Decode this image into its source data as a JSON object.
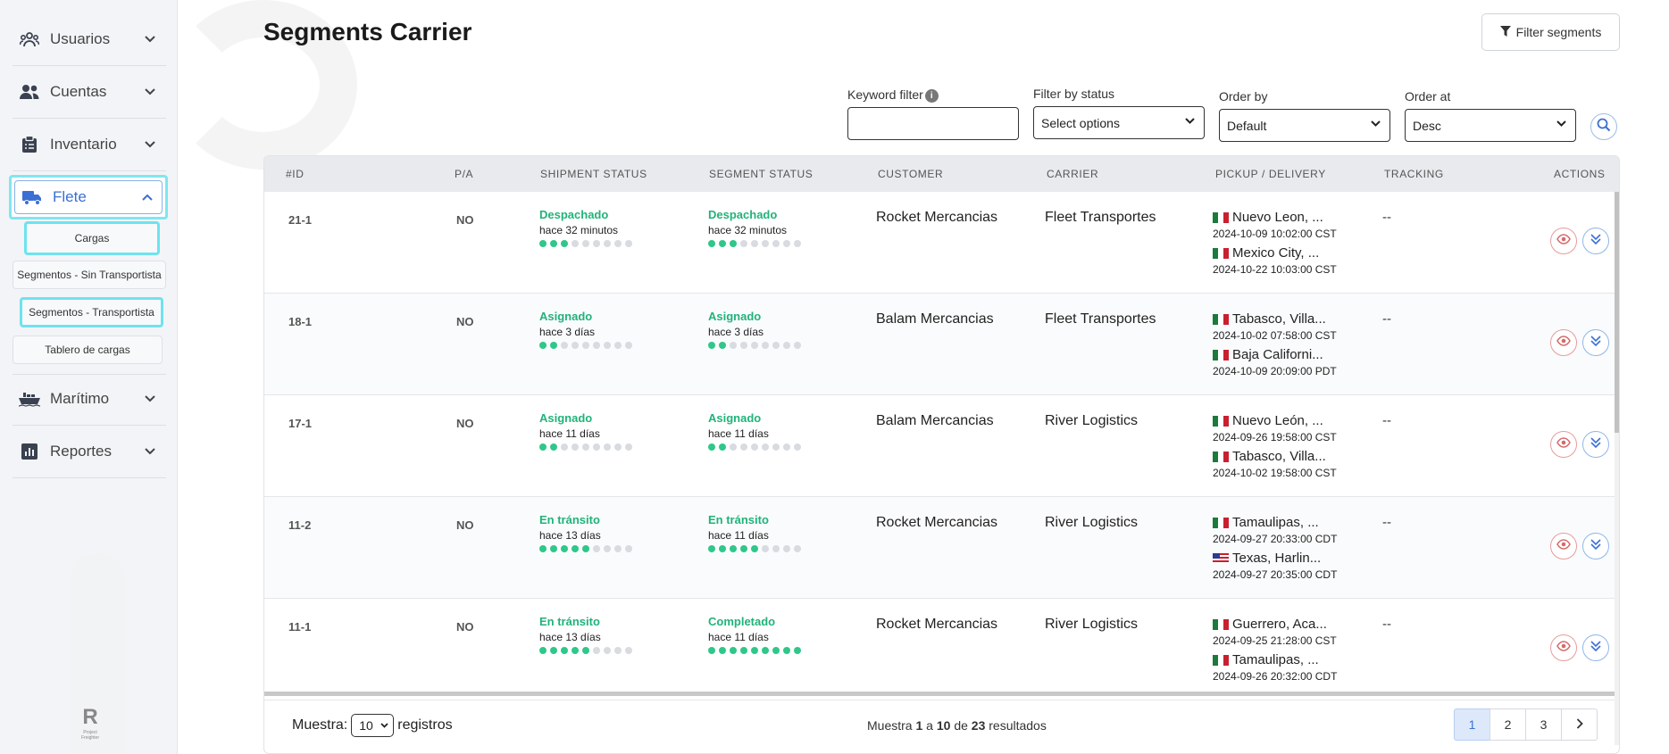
{
  "sidebar": {
    "items": [
      {
        "label": "Usuarios",
        "icon": "users-group-icon",
        "chevron": "chevron-down-icon"
      },
      {
        "label": "Cuentas",
        "icon": "user-pair-icon",
        "chevron": "chevron-down-icon"
      },
      {
        "label": "Inventario",
        "icon": "clipboard-icon",
        "chevron": "chevron-down-icon"
      },
      {
        "label": "Flete",
        "icon": "truck-icon",
        "chevron": "chevron-up-icon"
      },
      {
        "label": "Marítimo",
        "icon": "ship-icon",
        "chevron": "chevron-down-icon"
      },
      {
        "label": "Reportes",
        "icon": "chart-icon",
        "chevron": "chevron-down-icon"
      }
    ],
    "subitems": [
      "Cargas",
      "Segmentos - Sin Transportista",
      "Segmentos - Transportista",
      "Tablero de cargas"
    ],
    "logo": {
      "mark": "R",
      "caption": "Project Freighter"
    }
  },
  "header": {
    "title": "Segments Carrier",
    "filter_button": "Filter segments"
  },
  "filters": {
    "keyword_label": "Keyword filter",
    "keyword_value": "",
    "status_label": "Filter by status",
    "status_value": "Select options",
    "order_by_label": "Order by",
    "order_by_value": "Default",
    "order_at_label": "Order at",
    "order_at_value": "Desc"
  },
  "table": {
    "columns": [
      "#ID",
      "P/A",
      "SHIPMENT STATUS",
      "SEGMENT STATUS",
      "CUSTOMER",
      "CARRIER",
      "PICKUP / DELIVERY",
      "TRACKING",
      "ACTIONS"
    ],
    "rows": [
      {
        "id": "21-1",
        "pa": "NO",
        "ship_status": "Despachado",
        "ship_time": "hace 32 minutos",
        "ship_progress": 3,
        "seg_status": "Despachado",
        "seg_time": "hace 32 minutos",
        "seg_progress": 3,
        "customer": "Rocket Mercancias",
        "carrier": "Fleet Transportes",
        "pickup": "Nuevo Leon, ...",
        "pickup_flag": "mx",
        "pickup_date": "2024-10-09 10:02:00 CST",
        "delivery": "Mexico City, ...",
        "delivery_flag": "mx",
        "delivery_date": "2024-10-22 10:03:00 CST",
        "tracking": "--"
      },
      {
        "id": "18-1",
        "pa": "NO",
        "ship_status": "Asignado",
        "ship_time": "hace 3 días",
        "ship_progress": 2,
        "seg_status": "Asignado",
        "seg_time": "hace 3 días",
        "seg_progress": 2,
        "customer": "Balam Mercancias",
        "carrier": "Fleet Transportes",
        "pickup": "Tabasco, Villa...",
        "pickup_flag": "mx",
        "pickup_date": "2024-10-02 07:58:00 CST",
        "delivery": "Baja Californi...",
        "delivery_flag": "mx",
        "delivery_date": "2024-10-09 20:09:00 PDT",
        "tracking": "--"
      },
      {
        "id": "17-1",
        "pa": "NO",
        "ship_status": "Asignado",
        "ship_time": "hace 11 días",
        "ship_progress": 2,
        "seg_status": "Asignado",
        "seg_time": "hace 11 días",
        "seg_progress": 2,
        "customer": "Balam Mercancias",
        "carrier": "River Logistics",
        "pickup": "Nuevo León, ...",
        "pickup_flag": "mx",
        "pickup_date": "2024-09-26 19:58:00 CST",
        "delivery": "Tabasco, Villa...",
        "delivery_flag": "mx",
        "delivery_date": "2024-10-02 19:58:00 CST",
        "tracking": "--"
      },
      {
        "id": "11-2",
        "pa": "NO",
        "ship_status": "En tránsito",
        "ship_time": "hace 13 días",
        "ship_progress": 5,
        "seg_status": "En tránsito",
        "seg_time": "hace 11 días",
        "seg_progress": 5,
        "customer": "Rocket Mercancias",
        "carrier": "River Logistics",
        "pickup": "Tamaulipas, ...",
        "pickup_flag": "mx",
        "pickup_date": "2024-09-27 20:33:00 CDT",
        "delivery": "Texas, Harlin...",
        "delivery_flag": "us",
        "delivery_date": "2024-09-27 20:35:00 CDT",
        "tracking": "--"
      },
      {
        "id": "11-1",
        "pa": "NO",
        "ship_status": "En tránsito",
        "ship_time": "hace 13 días",
        "ship_progress": 5,
        "seg_status": "Completado",
        "seg_time": "hace 11 días",
        "seg_progress": 9,
        "customer": "Rocket Mercancias",
        "carrier": "River Logistics",
        "pickup": "Guerrero, Aca...",
        "pickup_flag": "mx",
        "pickup_date": "2024-09-25 21:28:00 CST",
        "delivery": "Tamaulipas, ...",
        "delivery_flag": "mx",
        "delivery_date": "2024-09-26 20:32:00 CDT",
        "tracking": "--"
      }
    ],
    "progress_steps": 9
  },
  "footer": {
    "show_label": "Muestra:",
    "page_size": "10",
    "records_label": "registros",
    "summary": {
      "prefix": "Muestra",
      "from": "1",
      "a": "a",
      "to": "10",
      "de": "de",
      "total": "23",
      "suffix": "resultados"
    },
    "pages": [
      "1",
      "2",
      "3"
    ],
    "current_page": "1",
    "next": "›"
  },
  "colors": {
    "accent": "#3b6fd4",
    "status_green": "#20b37a",
    "highlight": "#7fe6f0"
  }
}
